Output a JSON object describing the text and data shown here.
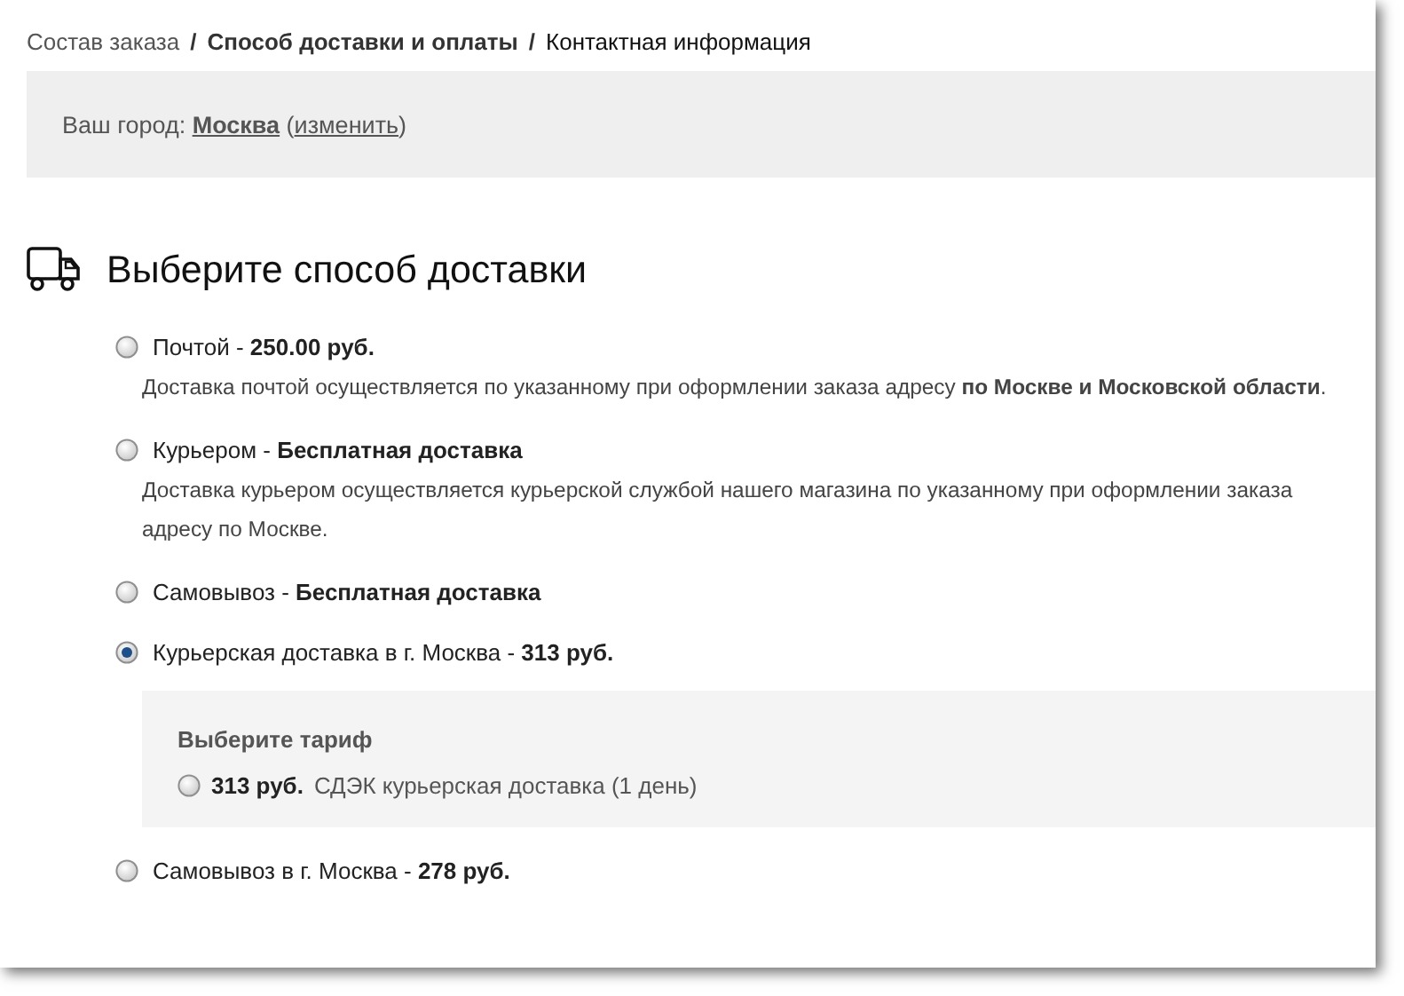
{
  "breadcrumbs": [
    {
      "label": "Состав заказа",
      "separator": "/",
      "kind": "done"
    },
    {
      "label": "Способ доставки и оплаты",
      "separator": "/",
      "kind": "current"
    },
    {
      "label": "Контактная информация",
      "kind": "next"
    }
  ],
  "city_bar": {
    "label": "Ваш город:",
    "city": "Москва",
    "open": "(",
    "change_link": "изменить",
    "close": ")"
  },
  "heading": "Выберите способ доставки",
  "options": [
    {
      "label": "Почтой - **250.00 руб.**",
      "description": "Доставка почтой осуществляется по указанному при оформлении заказа адресу **по Москве и Московской области**.",
      "selected": false
    },
    {
      "label": "Курьером - **Бесплатная доставка**",
      "description": "Доставка курьером осуществляется курьерской службой нашего магазина по указанному при оформлении заказа адресу по Москве.",
      "selected": false
    },
    {
      "label": "Самовывоз - **Бесплатная доставка**",
      "selected": false
    },
    {
      "label": "Курьерская доставка в г. Москва - **313 руб.**",
      "selected": true,
      "tariffs": {
        "title": "Выберите тариф",
        "items": [
          {
            "price": "313 руб.",
            "name": "СДЭК курьерская доставка (1 день)",
            "selected": false
          }
        ]
      }
    },
    {
      "label": "Самовывоз в г. Москва - **278 руб.**",
      "selected": false
    }
  ]
}
